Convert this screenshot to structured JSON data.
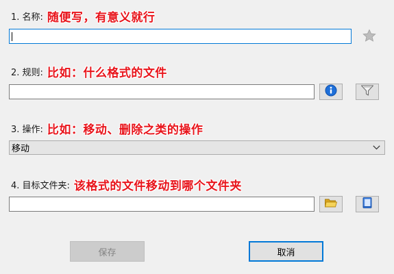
{
  "fields": {
    "name": {
      "label": "1. 名称:",
      "note": "随便写，有意义就行",
      "value": ""
    },
    "rule": {
      "label": "2. 规则:",
      "note": "比如：什么格式的文件",
      "value": ""
    },
    "operation": {
      "label": "3. 操作:",
      "note": "比如：移动、删除之类的操作",
      "selected": "移动"
    },
    "target_folder": {
      "label": "4. 目标文件夹:",
      "note": "该格式的文件移动到哪个文件夹",
      "value": ""
    }
  },
  "buttons": {
    "save": "保存",
    "cancel": "取消"
  },
  "icons": {
    "favorite": "star-icon",
    "info": "info-icon",
    "filter": "filter-icon",
    "browse_folder": "folder-icon",
    "book": "book-icon",
    "dropdown": "chevron-down-icon"
  },
  "colors": {
    "note_text": "#e8141b",
    "focus_border": "#0078d7",
    "info_blue": "#1e6fd9"
  }
}
